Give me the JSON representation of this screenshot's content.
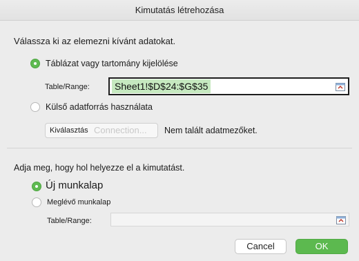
{
  "window": {
    "title": "Kimutatás létrehozása"
  },
  "source_section": {
    "heading": "Válassza ki az elemezni kívánt adatokat.",
    "option_table": {
      "label": "Táblázat vagy tartomány kijelölése",
      "selected": true
    },
    "table_range": {
      "label": "Table/Range:",
      "value": "Sheet1!$D$24:$G$35"
    },
    "option_external": {
      "label": "Külső adatforrás használata",
      "selected": false
    },
    "choose_button": {
      "label": "Kiválasztás",
      "ghost_label": "Connection..."
    },
    "no_fields_text": "Nem talált adatmezőket."
  },
  "destination_section": {
    "heading": "Adja meg, hogy hol helyezze el a kimutatást.",
    "option_new_sheet": {
      "label": "Új munkalap",
      "selected": true
    },
    "option_existing_sheet": {
      "label": "Meglévő munkalap",
      "selected": false
    },
    "table_range": {
      "label": "Table/Range:",
      "value": ""
    }
  },
  "buttons": {
    "cancel": "Cancel",
    "ok": "OK"
  },
  "colors": {
    "accent": "#5fba52",
    "selection_fill": "#c6e9c0"
  }
}
